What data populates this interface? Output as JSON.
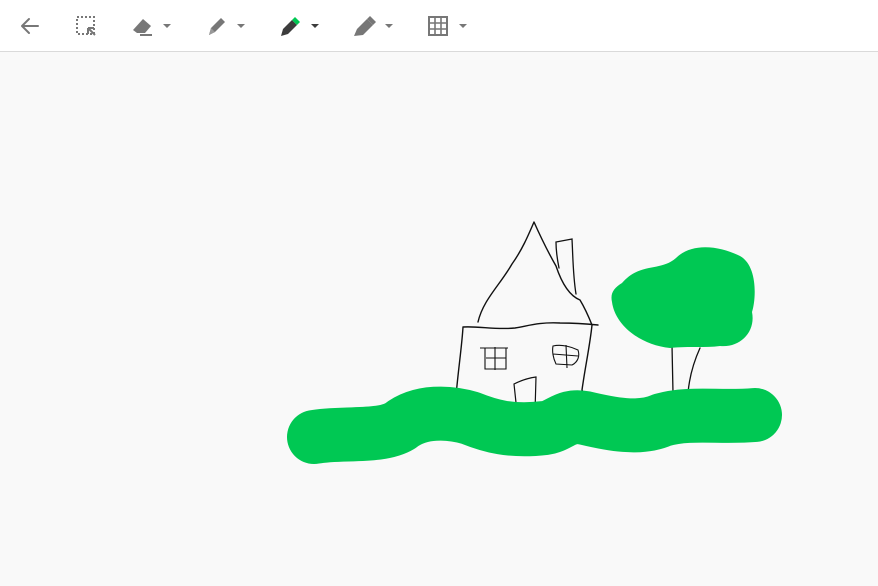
{
  "toolbar": {
    "tools": [
      {
        "id": "back",
        "icon": "arrow-left-icon"
      },
      {
        "id": "select",
        "icon": "lasso-select-icon"
      },
      {
        "id": "eraser",
        "icon": "eraser-icon",
        "has_dropdown": true
      },
      {
        "id": "pen",
        "icon": "pen-icon",
        "has_dropdown": true
      },
      {
        "id": "marker",
        "icon": "marker-icon",
        "has_dropdown": true,
        "active": true
      },
      {
        "id": "highlighter",
        "icon": "highlighter-icon",
        "has_dropdown": true
      },
      {
        "id": "grid",
        "icon": "grid-icon",
        "has_dropdown": true
      }
    ]
  },
  "colors": {
    "background": "#f9f9f9",
    "toolbar": "#ffffff",
    "icon": "#777777",
    "active_icon": "#3c3c3c",
    "marker_accent": "#00c853",
    "drawing_green": "#00c853",
    "ink": "#111111"
  }
}
